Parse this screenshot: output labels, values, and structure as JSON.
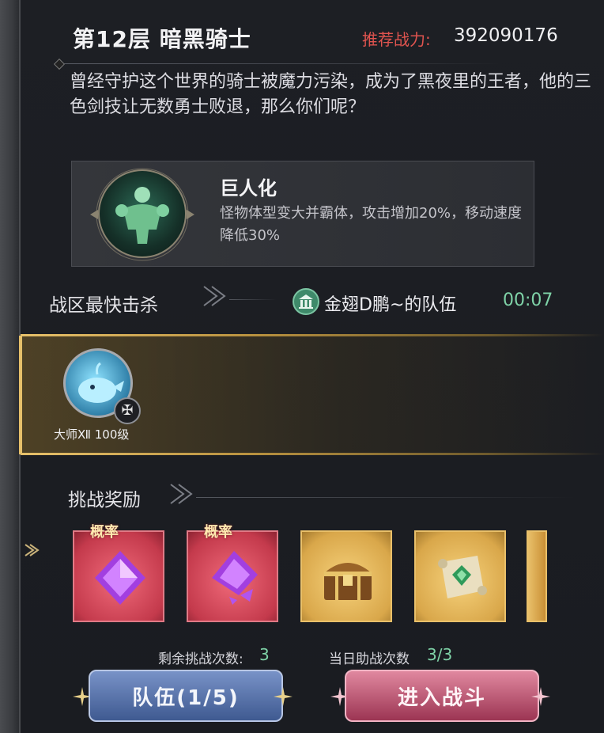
{
  "stage": {
    "title": "第12层  暗黑骑士",
    "power_label": "推荐战力:",
    "power_value": "392090176",
    "description": "曾经守护这个世界的骑士被魔力污染，成为了黑夜里的王者，他的三色剑技让无数勇士败退，那么你们呢？"
  },
  "buff": {
    "icon": "giant-icon",
    "title": "巨人化",
    "description": "怪物体型变大并霸体，攻击增加20%，移动速度降低30%"
  },
  "fastest_kill": {
    "label": "战区最快击杀",
    "team_icon": "temple-icon",
    "team_name": "金翅D鹏~的队伍",
    "time": "00:07"
  },
  "player": {
    "avatar_icon": "whale-avatar",
    "badge_icon": "rank-emblem-icon",
    "caption": "大师Ⅻ 100级"
  },
  "rewards": {
    "label": "挑战奖励",
    "items": [
      {
        "tag": "概率",
        "icon": "purple-crystal-icon",
        "style": "red"
      },
      {
        "tag": "概率",
        "icon": "purple-crystal-shard-icon",
        "style": "red"
      },
      {
        "tag": "",
        "icon": "treasure-chest-icon",
        "style": "gold"
      },
      {
        "tag": "",
        "icon": "green-scroll-icon",
        "style": "gold"
      }
    ]
  },
  "counts": {
    "remaining_label": "剩余挑战次数:",
    "remaining_value": "3",
    "assist_label": "当日助战次数",
    "assist_value": "3/3"
  },
  "buttons": {
    "team": "队伍(1/5)",
    "fight": "进入战斗"
  },
  "colors": {
    "power_label": "#e0544f",
    "accent_green": "#7fd3a8",
    "gold_band": "#e6c06a",
    "team_button": "#4f6aa3",
    "fight_button": "#b8465f"
  }
}
